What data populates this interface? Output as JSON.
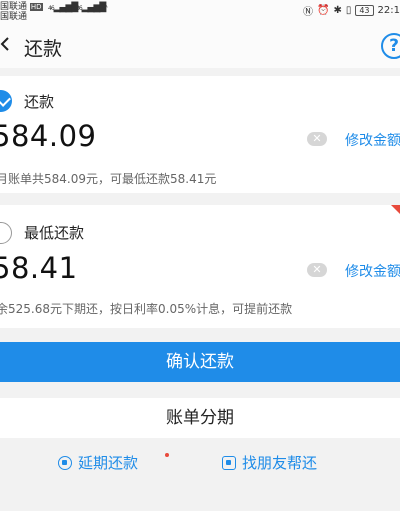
{
  "status_bar": {
    "carrier1": "国联通",
    "carrier1_badge": "HD",
    "carrier2": "国联通",
    "signal1": "46",
    "signal2": "36",
    "battery": "43",
    "time": "22:1"
  },
  "header": {
    "title": "还款",
    "help": "?"
  },
  "options": [
    {
      "label": "还款",
      "amount": "584.09",
      "modify": "修改金额",
      "desc": "月账单共584.09元，可最低还款58.41元"
    },
    {
      "label": "最低还款",
      "amount": "58.41",
      "modify": "修改金额",
      "desc": "余525.68元下期还，按日利率0.05%计息，可提前还款"
    }
  ],
  "buttons": {
    "confirm": "确认还款",
    "installment": "账单分期"
  },
  "links": {
    "defer": "延期还款",
    "friend": "找朋友帮还"
  },
  "colors": {
    "accent": "#1f8ce8",
    "badge_red": "#e84a3c"
  }
}
